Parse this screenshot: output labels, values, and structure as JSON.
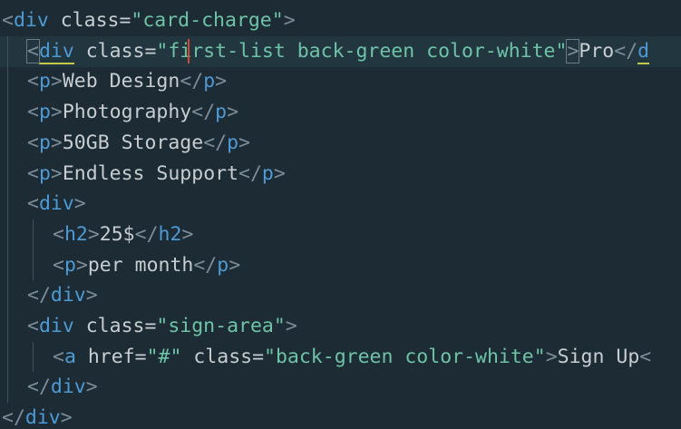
{
  "editor": {
    "language": "html",
    "lines": [
      {
        "indent": 0,
        "tokens": [
          {
            "t": "<",
            "k": "punc"
          },
          {
            "t": "div",
            "k": "tag"
          },
          {
            "t": " class=",
            "k": "attr"
          },
          {
            "t": "\"card-charge\"",
            "k": "str"
          },
          {
            "t": ">",
            "k": "punc"
          }
        ]
      },
      {
        "indent": 1,
        "current": true,
        "tokens": [
          {
            "t": "<",
            "k": "punc",
            "box": true
          },
          {
            "t": "div",
            "k": "tag",
            "underline": true
          },
          {
            "t": " class=",
            "k": "attr"
          },
          {
            "t": "\"first-list back-green color-white\"",
            "k": "str"
          },
          {
            "t": ">",
            "k": "punc",
            "box": true
          },
          {
            "t": "Pro",
            "k": "text"
          },
          {
            "t": "</",
            "k": "punc"
          },
          {
            "t": "d",
            "k": "tag",
            "underline": true
          }
        ]
      },
      {
        "indent": 1,
        "tokens": [
          {
            "t": "<",
            "k": "punc"
          },
          {
            "t": "p",
            "k": "tag"
          },
          {
            "t": ">",
            "k": "punc"
          },
          {
            "t": "Web Design",
            "k": "text"
          },
          {
            "t": "</",
            "k": "punc"
          },
          {
            "t": "p",
            "k": "tag"
          },
          {
            "t": ">",
            "k": "punc"
          }
        ]
      },
      {
        "indent": 1,
        "tokens": [
          {
            "t": "<",
            "k": "punc"
          },
          {
            "t": "p",
            "k": "tag"
          },
          {
            "t": ">",
            "k": "punc"
          },
          {
            "t": "Photography",
            "k": "text"
          },
          {
            "t": "</",
            "k": "punc"
          },
          {
            "t": "p",
            "k": "tag"
          },
          {
            "t": ">",
            "k": "punc"
          }
        ]
      },
      {
        "indent": 1,
        "tokens": [
          {
            "t": "<",
            "k": "punc"
          },
          {
            "t": "p",
            "k": "tag"
          },
          {
            "t": ">",
            "k": "punc"
          },
          {
            "t": "50GB Storage",
            "k": "text"
          },
          {
            "t": "</",
            "k": "punc"
          },
          {
            "t": "p",
            "k": "tag"
          },
          {
            "t": ">",
            "k": "punc"
          }
        ]
      },
      {
        "indent": 1,
        "tokens": [
          {
            "t": "<",
            "k": "punc"
          },
          {
            "t": "p",
            "k": "tag"
          },
          {
            "t": ">",
            "k": "punc"
          },
          {
            "t": "Endless Support",
            "k": "text"
          },
          {
            "t": "</",
            "k": "punc"
          },
          {
            "t": "p",
            "k": "tag"
          },
          {
            "t": ">",
            "k": "punc"
          }
        ]
      },
      {
        "indent": 1,
        "tokens": [
          {
            "t": "<",
            "k": "punc"
          },
          {
            "t": "div",
            "k": "tag"
          },
          {
            "t": ">",
            "k": "punc"
          }
        ]
      },
      {
        "indent": 2,
        "tokens": [
          {
            "t": "<",
            "k": "punc"
          },
          {
            "t": "h2",
            "k": "tag"
          },
          {
            "t": ">",
            "k": "punc"
          },
          {
            "t": "25$",
            "k": "text"
          },
          {
            "t": "</",
            "k": "punc"
          },
          {
            "t": "h2",
            "k": "tag"
          },
          {
            "t": ">",
            "k": "punc"
          }
        ]
      },
      {
        "indent": 2,
        "tokens": [
          {
            "t": "<",
            "k": "punc"
          },
          {
            "t": "p",
            "k": "tag"
          },
          {
            "t": ">",
            "k": "punc"
          },
          {
            "t": "per month",
            "k": "text"
          },
          {
            "t": "</",
            "k": "punc"
          },
          {
            "t": "p",
            "k": "tag"
          },
          {
            "t": ">",
            "k": "punc"
          }
        ]
      },
      {
        "indent": 1,
        "tokens": [
          {
            "t": "</",
            "k": "punc"
          },
          {
            "t": "div",
            "k": "tag"
          },
          {
            "t": ">",
            "k": "punc"
          }
        ]
      },
      {
        "indent": 1,
        "tokens": [
          {
            "t": "<",
            "k": "punc"
          },
          {
            "t": "div",
            "k": "tag"
          },
          {
            "t": " class=",
            "k": "attr"
          },
          {
            "t": "\"sign-area\"",
            "k": "str"
          },
          {
            "t": ">",
            "k": "punc"
          }
        ]
      },
      {
        "indent": 2,
        "tokens": [
          {
            "t": "<",
            "k": "punc"
          },
          {
            "t": "a",
            "k": "tag"
          },
          {
            "t": " href=",
            "k": "attr"
          },
          {
            "t": "\"#\"",
            "k": "str"
          },
          {
            "t": " class=",
            "k": "attr"
          },
          {
            "t": "\"back-green color-white\"",
            "k": "str"
          },
          {
            "t": ">",
            "k": "punc"
          },
          {
            "t": "Sign Up",
            "k": "text"
          },
          {
            "t": "<",
            "k": "punc"
          }
        ]
      },
      {
        "indent": 1,
        "tokens": [
          {
            "t": "</",
            "k": "punc"
          },
          {
            "t": "div",
            "k": "tag"
          },
          {
            "t": ">",
            "k": "punc"
          }
        ]
      },
      {
        "indent": 0,
        "tokens": [
          {
            "t": "</",
            "k": "punc"
          },
          {
            "t": "div",
            "k": "tag"
          },
          {
            "t": ">",
            "k": "punc"
          }
        ]
      }
    ]
  },
  "colors": {
    "background": "#1c2b34",
    "current_line": "#223640",
    "tag": "#4e9ad4",
    "string": "#6ec3a7",
    "text": "#c7cdd1",
    "punctuation": "#7b8d97",
    "cursor": "#d04a35"
  }
}
